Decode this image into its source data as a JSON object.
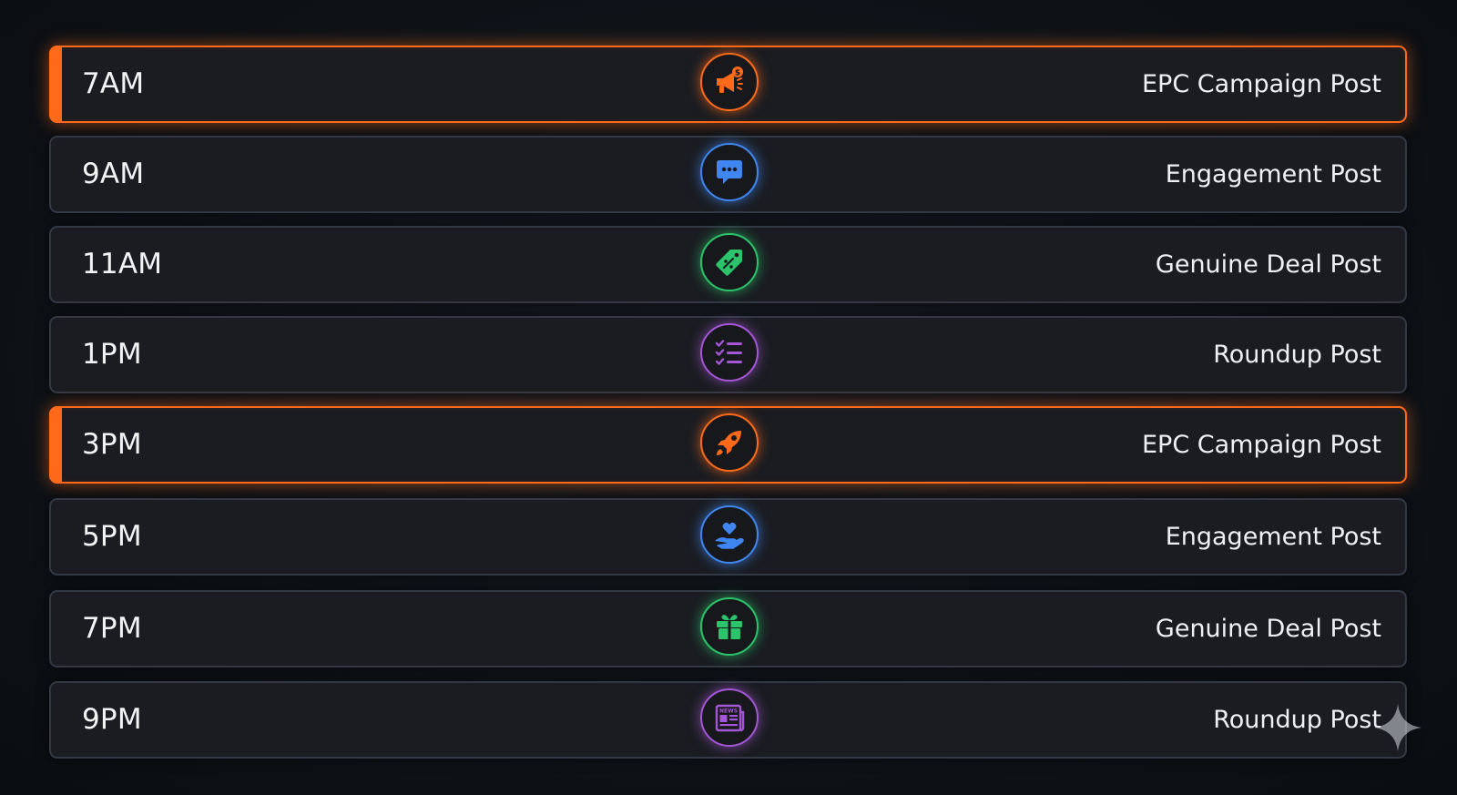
{
  "schedule": [
    {
      "time": "7AM",
      "label": "EPC Campaign Post",
      "highlighted": true,
      "icon": "megaphone-dollar-icon",
      "color": "#ff6a1a"
    },
    {
      "time": "9AM",
      "label": "Engagement Post",
      "highlighted": false,
      "icon": "chat-bubble-icon",
      "color": "#3f86f0"
    },
    {
      "time": "11AM",
      "label": "Genuine Deal Post",
      "highlighted": false,
      "icon": "discount-tag-icon",
      "color": "#2bc46a"
    },
    {
      "time": "1PM",
      "label": "Roundup Post",
      "highlighted": false,
      "icon": "checklist-icon",
      "color": "#a556d6"
    },
    {
      "time": "3PM",
      "label": "EPC Campaign Post",
      "highlighted": true,
      "icon": "rocket-icon",
      "color": "#ff6a1a"
    },
    {
      "time": "5PM",
      "label": "Engagement Post",
      "highlighted": false,
      "icon": "heart-hand-icon",
      "color": "#3f86f0"
    },
    {
      "time": "7PM",
      "label": "Genuine Deal Post",
      "highlighted": false,
      "icon": "gift-icon",
      "color": "#2bc46a"
    },
    {
      "time": "9PM",
      "label": "Roundup Post",
      "highlighted": false,
      "icon": "newspaper-icon",
      "color": "#a556d6"
    }
  ],
  "icon_text": {
    "newspaper": "NEWS"
  },
  "colors": {
    "accent_orange": "#ff6a1a",
    "accent_blue": "#3f86f0",
    "accent_green": "#2bc46a",
    "accent_purple": "#a556d6",
    "row_background": "#1a1c21",
    "page_background": "#0f1318"
  }
}
